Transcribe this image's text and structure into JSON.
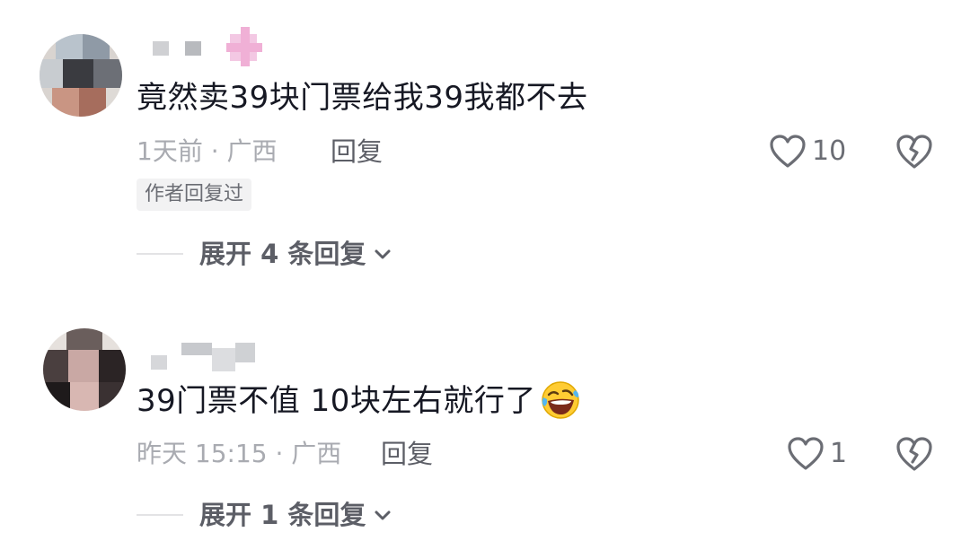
{
  "comments": [
    {
      "text": "竟然卖39块门票给我39我都不去",
      "time_location": "1天前 · 广西",
      "reply_label": "回复",
      "author_badge": "作者回复过",
      "like_count": "10",
      "expand_label": "展开 4 条回复"
    },
    {
      "text": "39门票不值  10块左右就行了",
      "emoji": "rolling-laughing-emoji",
      "time_location": "昨天 15:15 · 广西",
      "reply_label": "回复",
      "like_count": "1",
      "expand_label": "展开 1 条回复"
    }
  ],
  "icons": {
    "like": "heart-outline-icon",
    "dislike": "broken-heart-icon",
    "expand": "chevron-down-icon"
  },
  "colors": {
    "primary_text": "#161823",
    "secondary_text": "#a9abb1",
    "action_text": "#5c5e66",
    "badge_bg": "#f2f2f3"
  }
}
